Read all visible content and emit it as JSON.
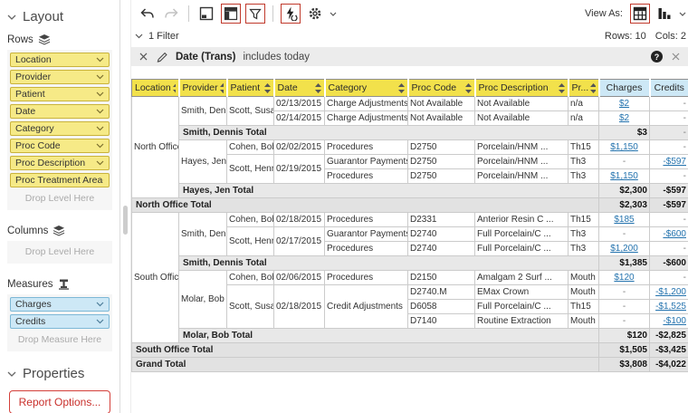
{
  "colors": {
    "accent_red": "#c0392b",
    "header_yellow": "#f2e14b",
    "measure_blue": "#cde8f6",
    "link_blue": "#2473ae"
  },
  "sidebar": {
    "layout_title": "Layout",
    "rows_label": "Rows",
    "row_levels": [
      "Location",
      "Provider",
      "Patient",
      "Date",
      "Category",
      "Proc Code",
      "Proc Description",
      "Proc Treatment Area"
    ],
    "rows_drop_text": "Drop Level Here",
    "columns_label": "Columns",
    "columns_drop_text": "Drop Level Here",
    "measures_label": "Measures",
    "measures": [
      "Charges",
      "Credits"
    ],
    "measures_drop_text": "Drop Measure Here",
    "properties_title": "Properties",
    "report_options_label": "Report Options..."
  },
  "toolbar": {
    "view_as_label": "View As:"
  },
  "filter_bar": {
    "summary": "1 Filter",
    "rows_count": "Rows: 10",
    "cols_count": "Cols: 2",
    "filter_name": "Date (Trans)",
    "filter_condition": "includes today",
    "help_glyph": "?"
  },
  "table": {
    "headers": [
      {
        "label": "Location",
        "type": "dim"
      },
      {
        "label": "Provider",
        "type": "dim"
      },
      {
        "label": "Patient",
        "type": "dim"
      },
      {
        "label": "Date",
        "type": "dim"
      },
      {
        "label": "Category",
        "type": "dim"
      },
      {
        "label": "Proc Code",
        "type": "dim"
      },
      {
        "label": "Proc Description",
        "type": "dim"
      },
      {
        "label": "Pr...",
        "type": "dim"
      },
      {
        "label": "Charges",
        "type": "measure"
      },
      {
        "label": "Credits",
        "type": "measure"
      }
    ],
    "rows": [
      {
        "type": "d",
        "cells": [
          {
            "t": "North Office",
            "rs": 7
          },
          {
            "t": "Smith, Dennis",
            "rs": 2
          },
          {
            "t": "Scott, Susan",
            "rs": 2
          },
          {
            "t": "02/13/2015"
          },
          {
            "t": "Charge Adjustments"
          },
          {
            "t": "Not Available"
          },
          {
            "t": "Not Available"
          },
          {
            "t": "n/a"
          },
          {
            "t": "$2",
            "link": true
          },
          {
            "t": "-"
          }
        ]
      },
      {
        "type": "d",
        "cells": [
          {
            "t": "02/14/2015"
          },
          {
            "t": "Charge Adjustments"
          },
          {
            "t": "Not Available"
          },
          {
            "t": "Not Available"
          },
          {
            "t": "n/a"
          },
          {
            "t": "$2",
            "link": true
          },
          {
            "t": "-"
          }
        ]
      },
      {
        "type": "s",
        "cells": [
          {
            "t": "Smith, Dennis Total",
            "cs": 7
          },
          {
            "t": "$3"
          },
          {
            "t": "-"
          }
        ]
      },
      {
        "type": "d",
        "cells": [
          {
            "t": "Hayes, Jen",
            "rs": 3
          },
          {
            "t": "Cohen, Bob"
          },
          {
            "t": "02/02/2015"
          },
          {
            "t": "Procedures"
          },
          {
            "t": "D2750"
          },
          {
            "t": "Porcelain/HNM ..."
          },
          {
            "t": "Th15"
          },
          {
            "t": "$1,150",
            "link": true
          },
          {
            "t": "-"
          }
        ]
      },
      {
        "type": "d",
        "cells": [
          {
            "t": "Scott, Henry",
            "rs": 2
          },
          {
            "t": "02/19/2015",
            "rs": 2
          },
          {
            "t": "Guarantor Payments"
          },
          {
            "t": "D2750"
          },
          {
            "t": "Porcelain/HNM ..."
          },
          {
            "t": "Th3"
          },
          {
            "t": "-"
          },
          {
            "t": "-$597",
            "link": true
          }
        ]
      },
      {
        "type": "d",
        "cells": [
          {
            "t": "Procedures"
          },
          {
            "t": "D2750"
          },
          {
            "t": "Porcelain/HNM ..."
          },
          {
            "t": "Th3"
          },
          {
            "t": "$1,150",
            "link": true
          },
          {
            "t": "-"
          }
        ]
      },
      {
        "type": "s",
        "cells": [
          {
            "t": "Hayes, Jen Total",
            "cs": 7
          },
          {
            "t": "$2,300"
          },
          {
            "t": "-$597"
          }
        ]
      },
      {
        "type": "o",
        "cells": [
          {
            "t": "North Office Total",
            "cs": 8
          },
          {
            "t": "$2,303"
          },
          {
            "t": "-$597"
          }
        ]
      },
      {
        "type": "d",
        "cells": [
          {
            "t": "South Office",
            "rs": 9
          },
          {
            "t": "Smith, Dennis",
            "rs": 3
          },
          {
            "t": "Cohen, Bob"
          },
          {
            "t": "02/18/2015"
          },
          {
            "t": "Procedures"
          },
          {
            "t": "D2331"
          },
          {
            "t": "Anterior Resin C ..."
          },
          {
            "t": "Th15"
          },
          {
            "t": "$185",
            "link": true
          },
          {
            "t": "-"
          }
        ]
      },
      {
        "type": "d",
        "cells": [
          {
            "t": "Scott, Henry",
            "rs": 2
          },
          {
            "t": "02/17/2015",
            "rs": 2
          },
          {
            "t": "Guarantor Payments"
          },
          {
            "t": "D2740"
          },
          {
            "t": "Full Porcelain/C ..."
          },
          {
            "t": "Th3"
          },
          {
            "t": "-"
          },
          {
            "t": "-$600",
            "link": true
          }
        ]
      },
      {
        "type": "d",
        "cells": [
          {
            "t": "Procedures"
          },
          {
            "t": "D2740"
          },
          {
            "t": "Full Porcelain/C ..."
          },
          {
            "t": "Th3"
          },
          {
            "t": "$1,200",
            "link": true
          },
          {
            "t": "-"
          }
        ]
      },
      {
        "type": "s",
        "cells": [
          {
            "t": "Smith, Dennis Total",
            "cs": 7
          },
          {
            "t": "$1,385"
          },
          {
            "t": "-$600"
          }
        ]
      },
      {
        "type": "d",
        "cells": [
          {
            "t": "Molar, Bob",
            "rs": 4
          },
          {
            "t": "Cohen, Bob"
          },
          {
            "t": "02/06/2015"
          },
          {
            "t": "Procedures"
          },
          {
            "t": "D2150"
          },
          {
            "t": "Amalgam 2 Surf ..."
          },
          {
            "t": "Mouth"
          },
          {
            "t": "$120",
            "link": true
          },
          {
            "t": "-"
          }
        ]
      },
      {
        "type": "d",
        "cells": [
          {
            "t": "Scott, Susan",
            "rs": 3
          },
          {
            "t": "02/18/2015",
            "rs": 3
          },
          {
            "t": "Credit Adjustments",
            "rs": 3
          },
          {
            "t": "D2740.M"
          },
          {
            "t": "EMax Crown"
          },
          {
            "t": "Mouth"
          },
          {
            "t": "-"
          },
          {
            "t": "-$1,200",
            "link": true
          }
        ]
      },
      {
        "type": "d",
        "cells": [
          {
            "t": "D6058"
          },
          {
            "t": "Full Porcelain/C ..."
          },
          {
            "t": "Th15"
          },
          {
            "t": "-"
          },
          {
            "t": "-$1,525",
            "link": true
          }
        ]
      },
      {
        "type": "d",
        "cells": [
          {
            "t": "D7140"
          },
          {
            "t": "Routine Extraction"
          },
          {
            "t": "Mouth"
          },
          {
            "t": "-"
          },
          {
            "t": "-$100",
            "link": true
          }
        ]
      },
      {
        "type": "s",
        "cells": [
          {
            "t": "Molar, Bob Total",
            "cs": 7
          },
          {
            "t": "$120"
          },
          {
            "t": "-$2,825"
          }
        ]
      },
      {
        "type": "o",
        "cells": [
          {
            "t": "South Office Total",
            "cs": 8
          },
          {
            "t": "$1,505"
          },
          {
            "t": "-$3,425"
          }
        ]
      },
      {
        "type": "g",
        "cells": [
          {
            "t": "Grand Total",
            "cs": 8
          },
          {
            "t": "$3,808"
          },
          {
            "t": "-$4,022"
          }
        ]
      }
    ]
  }
}
